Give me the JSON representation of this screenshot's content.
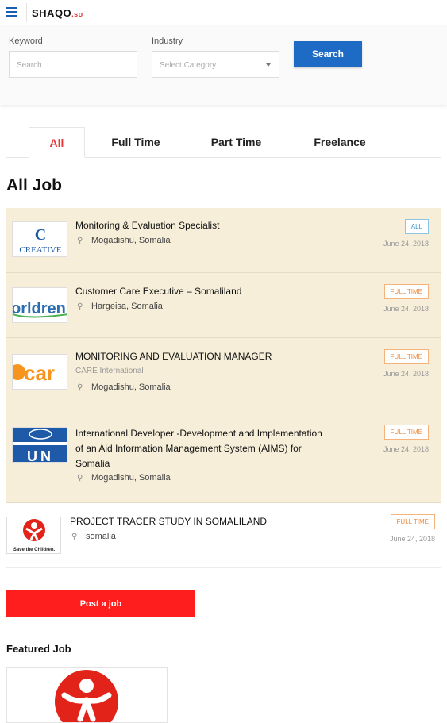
{
  "header": {
    "logo_main": "SHAQO",
    "logo_suffix": ".so",
    "menu_icon": "menu-icon"
  },
  "search": {
    "keyword_label": "Keyword",
    "keyword_placeholder": "Search",
    "industry_label": "Industry",
    "industry_selected": "Select Category",
    "search_button": "Search"
  },
  "tabs": [
    "All",
    "Full Time",
    "Part Time",
    "Freelance"
  ],
  "heading": "All Job",
  "jobs": [
    {
      "title_lines": [
        "Monitoring & Evaluation Specialist"
      ],
      "company": "",
      "location": "Mogadishu, Somalia",
      "badge": "ALL",
      "date": "June 24, 2018",
      "logo_text": "CREATIVE"
    },
    {
      "title_lines": [
        "Customer Care Executive – Somaliland"
      ],
      "company": "",
      "location": "Hargeisa, Somalia",
      "badge": "FULL TIME",
      "date": "June 24, 2018",
      "logo_text": "orldren"
    },
    {
      "title_lines": [
        "MONITORING AND EVALUATION MANAGER"
      ],
      "company": "CARE International",
      "location": "Mogadishu, Somalia",
      "badge": "FULL TIME",
      "date": "June 24, 2018",
      "logo_text": "car"
    },
    {
      "title_lines": [
        "International Developer -Development and Implementation",
        "of an Aid Information Management System (AIMS) for",
        "Somalia"
      ],
      "company": "",
      "location": "Mogadishu, Somalia",
      "badge": "FULL TIME",
      "date": "June 24, 2018",
      "logo_text": "UN"
    },
    {
      "title_lines": [
        "PROJECT TRACER STUDY IN SOMALILAND"
      ],
      "company": "",
      "location": "somalia",
      "badge": "FULL TIME",
      "date": "June 24, 2018",
      "logo_text": "Save the Children."
    }
  ],
  "post_button": "Post a job",
  "featured_title": "Featured Job",
  "colors": {
    "accent_red": "#e53935",
    "primary_blue": "#1e6bc5",
    "highlight_bg": "#f6eed8"
  }
}
